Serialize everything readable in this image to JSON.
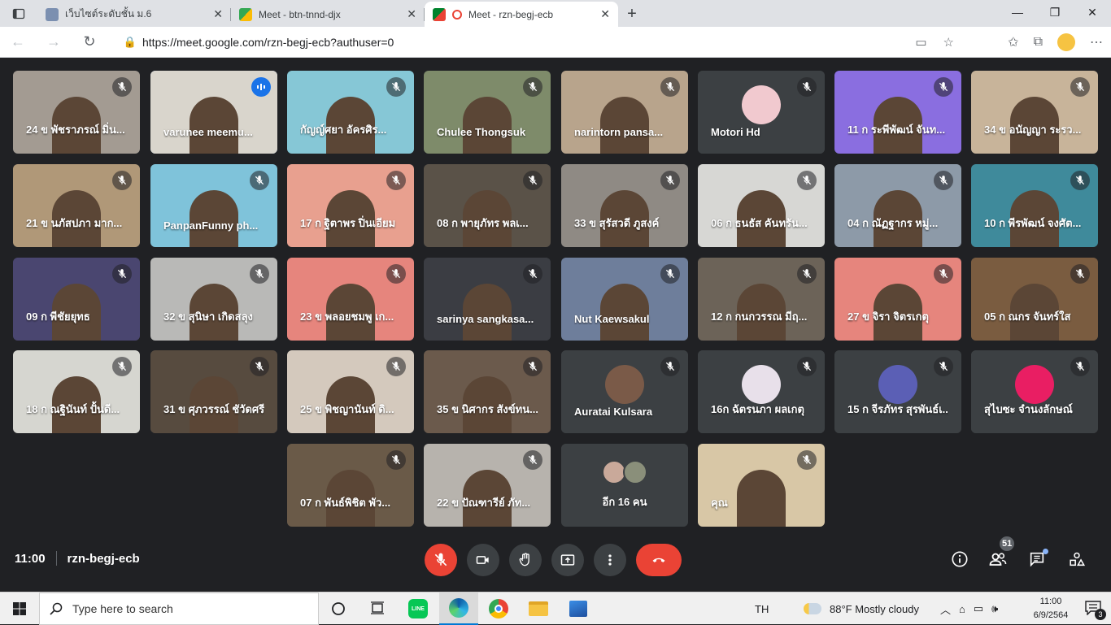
{
  "browser": {
    "tabs": [
      {
        "title": "เว็บไซต์ระดับชั้น ม.6",
        "favicon_color": "#5f6368",
        "active": false
      },
      {
        "title": "Meet - btn-tnnd-djx",
        "favicon_color": "#34a853",
        "active": false
      },
      {
        "title": "Meet - rzn-begj-ecb",
        "favicon_color": "#ea4335",
        "active": true
      }
    ],
    "url": "https://meet.google.com/rzn-begj-ecb?authuser=0"
  },
  "participants": [
    {
      "name": "24 ข พัชราภรณ์ มิ่น...",
      "bg": "#a39b92",
      "speaking": false
    },
    {
      "name": "varunee meemu...",
      "bg": "#d9d5cc",
      "speaking": true
    },
    {
      "name": "กัญญ์ศยา อัครศิร...",
      "bg": "#86c7d6",
      "speaking": false
    },
    {
      "name": "Chulee Thongsuk",
      "bg": "#7e8b6a",
      "speaking": false
    },
    {
      "name": "narintorn pansa...",
      "bg": "#b8a48c",
      "speaking": false
    },
    {
      "name": "Motori Hd",
      "bg": "#3c4043",
      "speaking": false,
      "avatar": "#f1c9cf"
    },
    {
      "name": "11 ก ระพีพัฒน์ จันท...",
      "bg": "#8a6ee0",
      "speaking": false
    },
    {
      "name": "34 ข อนัญญา ระรว...",
      "bg": "#c8b49a",
      "speaking": false
    },
    {
      "name": "21 ข นภัสปภา มาก...",
      "bg": "#b09878",
      "speaking": false
    },
    {
      "name": "PanpanFunny ph...",
      "bg": "#7fc3da",
      "speaking": false
    },
    {
      "name": "17 ก ฐิตาพร ปิ่นเอียม",
      "bg": "#e8a08f",
      "speaking": false
    },
    {
      "name": "08 ก พายุภัทร พลเ...",
      "bg": "#5a5248",
      "speaking": false
    },
    {
      "name": "33 ข สุรัสวดี ภูสงค์",
      "bg": "#8f8a84",
      "speaking": false
    },
    {
      "name": "06 ก ธนธัส คันทรัน...",
      "bg": "#d7d7d4",
      "speaking": false
    },
    {
      "name": "04 ก ณัฏฐากร หมู่...",
      "bg": "#8d9aa8",
      "speaking": false
    },
    {
      "name": "10 ก พีรพัฒน์ จงศัต...",
      "bg": "#3f8a9b",
      "speaking": false
    },
    {
      "name": "09 ก พีชัยยุทธ",
      "bg": "#4a4670",
      "speaking": false
    },
    {
      "name": "32 ข สุนิษา เกิดสลุง",
      "bg": "#b9b9b7",
      "speaking": false
    },
    {
      "name": "23 ข พลอยชมพู เก...",
      "bg": "#e6857d",
      "speaking": false
    },
    {
      "name": "sarinya sangkasa...",
      "bg": "#3b3d43",
      "speaking": false
    },
    {
      "name": "Nut Kaewsakul",
      "bg": "#6e7e9b",
      "speaking": false
    },
    {
      "name": "12 ก กนกวรรณ มีฤ...",
      "bg": "#6c6358",
      "speaking": false
    },
    {
      "name": "27 ข จิรา จิตรเกตุ",
      "bg": "#e6857d",
      "speaking": false
    },
    {
      "name": "05 ก ณกร จันทร์ใส",
      "bg": "#7a5c40",
      "speaking": false
    },
    {
      "name": "18 ก ณฐินันท์ ปั้นดี...",
      "bg": "#d6d6d0",
      "speaking": false
    },
    {
      "name": "31 ข ศุภวรรณ์ ชัวัดศรี",
      "bg": "#574b3f",
      "speaking": false
    },
    {
      "name": "25 ข พิชญานันท์ ดิ...",
      "bg": "#d4c9bd",
      "speaking": false
    },
    {
      "name": "35 ข นิศากร สังข์ทน...",
      "bg": "#6b5a4c",
      "speaking": false
    },
    {
      "name": "Auratai Kulsara",
      "bg": "#3c4043",
      "speaking": false,
      "avatar": "#7a5a48"
    },
    {
      "name": "16ก ฉัตรนภา ผลเกตุ",
      "bg": "#3c4043",
      "speaking": false,
      "avatar": "#e8e0ea"
    },
    {
      "name": "15 ก จีรภัทร สุรพันธ์เ...",
      "bg": "#3c4043",
      "speaking": false,
      "avatar": "#5b5fb5"
    },
    {
      "name": "สุไบซะ จำนงลักษณ์",
      "bg": "#3c4043",
      "speaking": false,
      "avatar": "#e91e63"
    },
    {
      "name": "07 ก พันธ์พิชิต พัว...",
      "bg": "#6a5a48",
      "speaking": false
    },
    {
      "name": "22 ข ปัณฑารีย์ ภัท...",
      "bg": "#b7b3ad",
      "speaking": false
    },
    {
      "name": "อีก 16 คน",
      "bg": "#3c4043",
      "speaking": false,
      "more": true
    },
    {
      "name": "คุณ",
      "bg": "#d8c7a6",
      "speaking": false
    }
  ],
  "meeting": {
    "time": "11:00",
    "code": "rzn-begj-ecb",
    "participant_count": "51"
  },
  "taskbar": {
    "search_placeholder": "Type here to search",
    "language": "TH",
    "weather": "88°F  Mostly cloudy",
    "clock_time": "11:00",
    "clock_date": "6/9/2564",
    "notification_count": "3"
  }
}
